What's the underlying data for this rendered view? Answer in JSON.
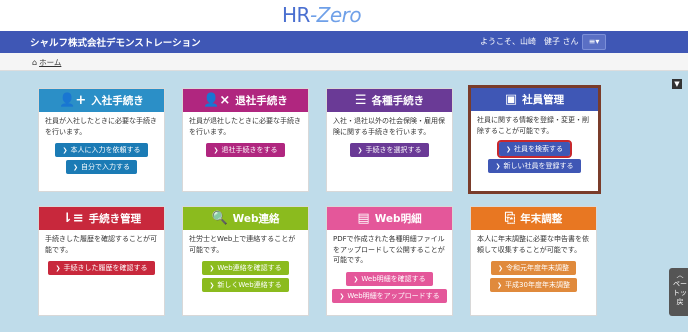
{
  "logo": {
    "text_a": "HR",
    "text_b": "-Zero"
  },
  "header": {
    "company": "シャルフ株式会社デモンストレーション",
    "greeting": "ようこそ、山崎　健子 さん",
    "menu_icon": "≡",
    "menu_caret": "▾"
  },
  "breadcrumb": {
    "home_icon": "⌂",
    "label": "ホーム"
  },
  "collapse_icon": "▼",
  "cards": {
    "join": {
      "title": "入社手続き",
      "icon": "👤+",
      "color": "#2b8fc7",
      "text": "社員が入社したときに必要な手続きを行います。",
      "buttons": [
        "本人に入力を依頼する",
        "自分で入力する"
      ],
      "btn_color": "#1b7bb5"
    },
    "leave": {
      "title": "退社手続き",
      "icon": "👤×",
      "color": "#b0267f",
      "text": "社員が退社したときに必要な手続きを行います。",
      "buttons": [
        "退社手続きをする"
      ],
      "btn_color": "#b0267f"
    },
    "various": {
      "title": "各種手続き",
      "icon": "☰",
      "color": "#6a3a96",
      "text": "入社・退社以外の社会保険・雇用保険に関する手続きを行います。",
      "buttons": [
        "手続きを選択する"
      ],
      "btn_color": "#6a3a96"
    },
    "employee": {
      "title": "社員管理",
      "icon": "▣",
      "color": "#3f57b5",
      "text": "社員に関する情報を登録・変更・削除することが可能です。",
      "buttons": [
        "社員を検索する",
        "新しい社員を登録する"
      ],
      "btn_color": "#3f57b5"
    },
    "history": {
      "title": "手続き管理",
      "icon": "⇂≡",
      "color": "#c8283c",
      "text": "手続きした履歴を確認することが可能です。",
      "buttons": [
        "手続きした履歴を確認する"
      ],
      "btn_color": "#c8283c"
    },
    "web": {
      "title": "Web連絡",
      "icon": "🔍",
      "color": "#8bbb1e",
      "text": "社労士とWeb上で連絡することが可能です。",
      "buttons": [
        "Web連絡を確認する",
        "新しくWeb連絡する"
      ],
      "btn_color": "#8bbb1e"
    },
    "payslip": {
      "title": "Web明細",
      "icon": "▤",
      "color": "#e4579a",
      "text": "PDFで作成された各種明細ファイルをアップロードして公開することが可能です。",
      "buttons": [
        "Web明細を確認する",
        "Web明細をアップロードする"
      ],
      "btn_color": "#e4579a"
    },
    "yearend": {
      "title": "年末調整",
      "icon": "⎘",
      "color": "#e87722",
      "text": "本人に年末調整に必要な申告書を依頼して収集することが可能です。",
      "buttons": [
        "令和元年度年末調整",
        "平成30年度年末調整"
      ],
      "btn_color": "#e08a3c"
    }
  },
  "page_top": {
    "line1": "ペー",
    "line2": "トッ",
    "line3": "戻"
  }
}
